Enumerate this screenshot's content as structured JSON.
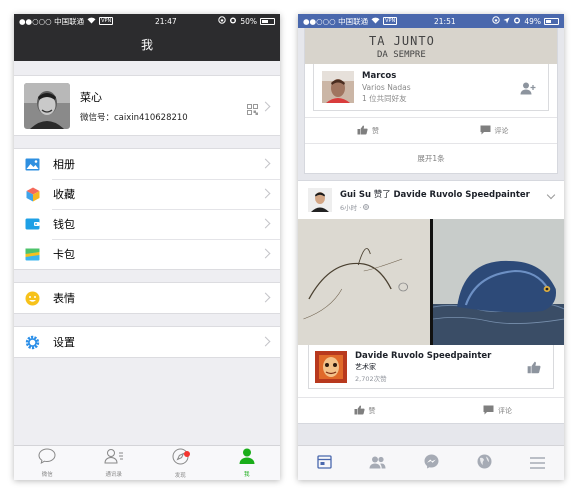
{
  "wechat": {
    "status": {
      "carrier": "●●○○○ 中国联通",
      "time": "21:47",
      "battery": "50%",
      "vpn": "VPN"
    },
    "title": "我",
    "profile": {
      "name": "菜心",
      "wechat_id": "微信号：caixin410628210"
    },
    "menu_groups": [
      [
        {
          "label": "相册",
          "icon": "photo-album-icon",
          "color": "#2e8fe0"
        },
        {
          "label": "收藏",
          "icon": "favorites-cube-icon",
          "color": "#f5a623"
        },
        {
          "label": "钱包",
          "icon": "wallet-icon",
          "color": "#1ea0e6"
        },
        {
          "label": "卡包",
          "icon": "card-pack-icon",
          "color": "#3bb6ee"
        }
      ],
      [
        {
          "label": "表情",
          "icon": "sticker-smile-icon",
          "color": "#f7c21a"
        }
      ],
      [
        {
          "label": "设置",
          "icon": "settings-gear-icon",
          "color": "#2a8ee8"
        }
      ]
    ],
    "tabs": [
      {
        "label": "微信",
        "icon": "chat-bubble-icon",
        "active": false
      },
      {
        "label": "通讯录",
        "icon": "contacts-icon",
        "active": false
      },
      {
        "label": "发现",
        "icon": "discover-compass-icon",
        "active": false
      },
      {
        "label": "我",
        "icon": "me-person-icon",
        "active": true
      }
    ],
    "accent": "#1aad19"
  },
  "facebook": {
    "status": {
      "carrier": "●●○○○ 中国联通",
      "time": "21:51",
      "battery": "49%",
      "vpn": "VPN"
    },
    "top_image_text": [
      "TA JUNTO",
      "DA SEMPRE"
    ],
    "friend_suggestion": {
      "name": "Marcos",
      "subtitle": "Varios Nadas",
      "mutual": "1 位共同好友"
    },
    "actions": {
      "like": "赞",
      "comment": "评论"
    },
    "expand_label": "展开1条",
    "post": {
      "actor": "Gui Su",
      "verb": "赞了",
      "target": "Davide Ruvolo Speedpainter",
      "time": "6小时 · "
    },
    "page_card": {
      "name": "Davide Ruvolo Speedpainter",
      "category": "艺术家",
      "likes": "2,702次赞"
    },
    "tabs": [
      "news-feed-icon",
      "friends-icon",
      "messenger-icon",
      "globe-notifications-icon",
      "menu-icon"
    ],
    "accent": "#4a68ad"
  }
}
